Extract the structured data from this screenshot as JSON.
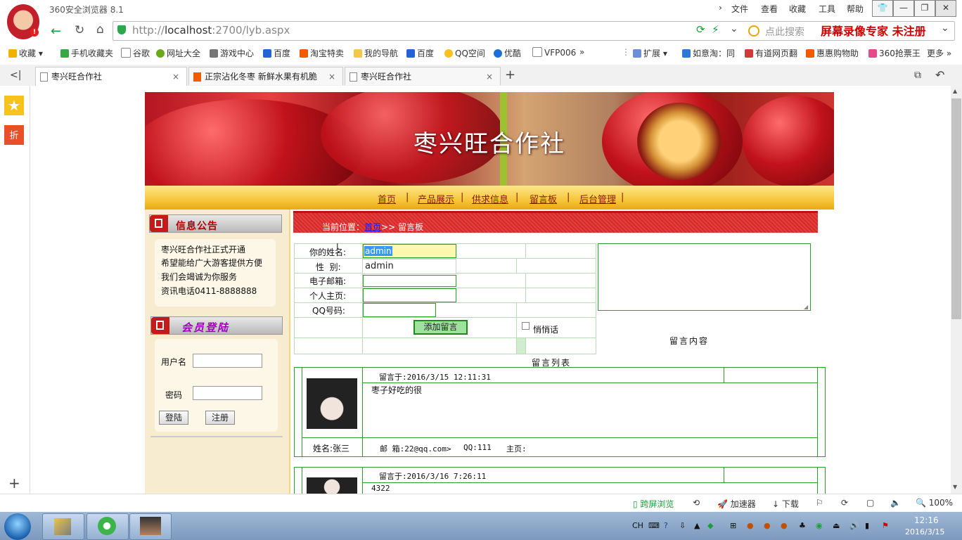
{
  "browser": {
    "app_title": "360安全浏览器 8.1",
    "menu": [
      "文件",
      "查看",
      "收藏",
      "工具",
      "帮助"
    ],
    "window_buttons": [
      "👕",
      "—",
      "❐",
      "✕"
    ],
    "url_prefix": "http://",
    "url_host": "localhost",
    "url_rest": ":2700/lyb.aspx",
    "search_placeholder": "点此搜索",
    "recorder_text": "屏幕录像专家  未注册",
    "bookmarks": [
      "收藏",
      "手机收藏夹",
      "谷歌",
      "网址大全",
      "游戏中心",
      "百度",
      "淘宝特卖",
      "我的导航",
      "百度",
      "QQ空间",
      "优酷",
      "VFP006",
      "»"
    ],
    "extensions": [
      "扩展",
      "如意淘：同",
      "有道网页翻",
      "惠惠购物助",
      "360抢票王",
      "更多"
    ],
    "tabs": [
      {
        "title": "枣兴旺合作社",
        "active": true
      },
      {
        "title": "正宗沾化冬枣 新鲜水果有机脆",
        "active": false
      },
      {
        "title": "枣兴旺合作社",
        "active": false
      }
    ],
    "status": {
      "cross_screen": "跨屏浏览",
      "accelerator": "加速器",
      "download": "下载",
      "zoom": "100%"
    }
  },
  "site": {
    "banner_title": "枣兴旺合作社",
    "nav": [
      "首页",
      "产品展示",
      "供求信息",
      "留言板",
      "后台管理"
    ],
    "notice": {
      "title": "信息公告",
      "lines": [
        "枣兴旺合作社正式开通",
        "希望能给广大游客提供方便",
        "我们会竭诚为你服务",
        "资讯电话0411-8888888"
      ]
    },
    "member": {
      "title": "会员登陆",
      "username_label": "用户名",
      "password_label": "密码",
      "login_button": "登陆",
      "register_button": "注册"
    },
    "breadcrumb": {
      "prefix": "当前位置：",
      "home": "首页",
      "current": ">> 留言板"
    },
    "form": {
      "name_label": "你的姓名:",
      "name_value": "admin",
      "autocomplete": "admin",
      "gender_label": "性  别:",
      "email_label": "电子邮箱:",
      "homepage_label": "个人主页:",
      "qq_label": "QQ号码:",
      "submit_button": "添加留言",
      "private_label": "悄悄话",
      "content_label": "留言内容"
    },
    "list_title": "留言列表",
    "messages": [
      {
        "date": "留言于:2016/3/15 12:11:31",
        "content": "枣子好吃的很",
        "name": "姓名:张三",
        "email": "邮 箱:22@qq.com>",
        "qq": "QQ:111",
        "homepage": "主页:"
      },
      {
        "date": "留言于:2016/3/16 7:26:11",
        "content": "4322"
      }
    ]
  },
  "taskbar": {
    "time": "12:16",
    "date": "2016/3/15",
    "lang": "CH"
  }
}
